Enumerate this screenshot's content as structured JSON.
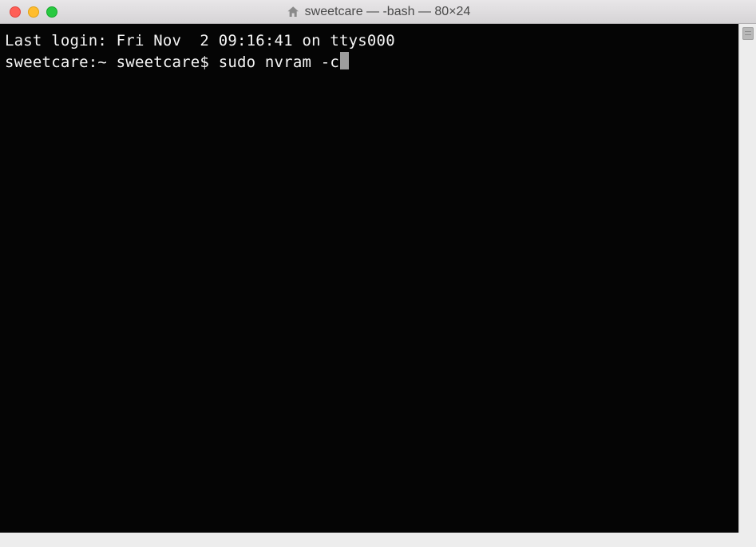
{
  "titlebar": {
    "title": "sweetcare — -bash — 80×24"
  },
  "terminal": {
    "last_login_line": "Last login: Fri Nov  2 09:16:41 on ttys000",
    "prompt": "sweetcare:~ sweetcare$ ",
    "command": "sudo nvram -c"
  }
}
